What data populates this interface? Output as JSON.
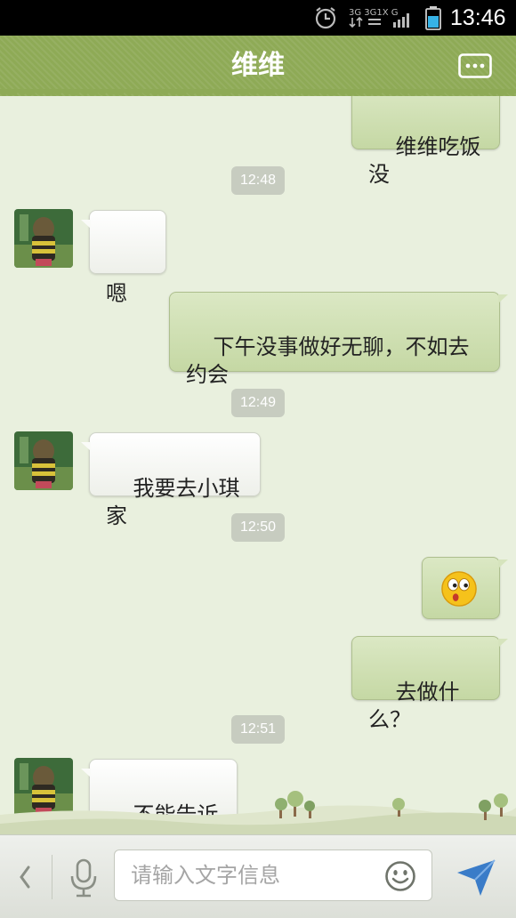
{
  "status_bar": {
    "time": "13:46",
    "alarm_icon": "alarm-clock-icon",
    "network_icon": "network-signal-icon",
    "battery_icon": "battery-icon"
  },
  "header": {
    "title": "维维",
    "menu_icon": "chat-menu-icon",
    "color": "#8eaa56"
  },
  "messages": [
    {
      "side": "right",
      "text": "维维吃饭没"
    },
    {
      "type": "time",
      "text": "12:48"
    },
    {
      "side": "left",
      "text": "嗯"
    },
    {
      "side": "right",
      "text": "下午没事做好无聊，不如去\n约会"
    },
    {
      "type": "time",
      "text": "12:49"
    },
    {
      "side": "left",
      "text": "我要去小琪家"
    },
    {
      "type": "time",
      "text": "12:50"
    },
    {
      "side": "right",
      "emoji": "surprised-face-emoji"
    },
    {
      "side": "right",
      "text": "去做什么？"
    },
    {
      "type": "time",
      "text": "12:51"
    },
    {
      "side": "left",
      "text": "不能告诉你"
    }
  ],
  "input_bar": {
    "placeholder": "请输入文字信息",
    "back_icon": "chevron-left-icon",
    "mic_icon": "microphone-icon",
    "emoji_icon": "smiley-icon",
    "send_icon": "send-arrow-icon"
  },
  "colors": {
    "background": "#e9f0de",
    "sent_bubble": "#d3e2b7",
    "received_bubble": "#ffffff",
    "send_button": "#3a7cc8"
  }
}
